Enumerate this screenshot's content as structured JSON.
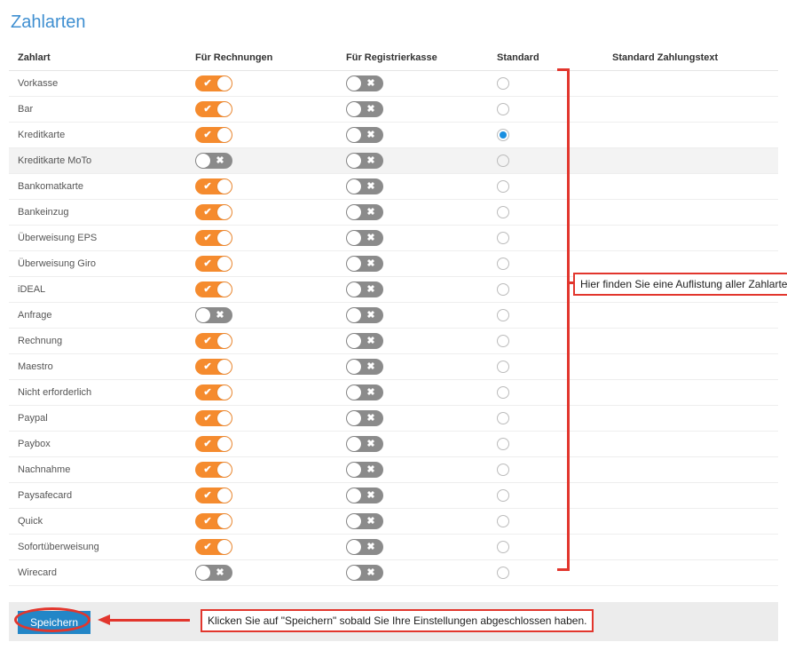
{
  "title": "Zahlarten",
  "columns": {
    "name": "Zahlart",
    "invoice": "Für Rechnungen",
    "register": "Für Registrierkasse",
    "standard": "Standard",
    "text": "Standard Zahlungstext"
  },
  "rows": [
    {
      "name": "Vorkasse",
      "invoice": true,
      "register": false,
      "standard": false,
      "highlight": false
    },
    {
      "name": "Bar",
      "invoice": true,
      "register": false,
      "standard": false,
      "highlight": false
    },
    {
      "name": "Kreditkarte",
      "invoice": true,
      "register": false,
      "standard": true,
      "highlight": false
    },
    {
      "name": "Kreditkarte MoTo",
      "invoice": false,
      "register": false,
      "standard": false,
      "highlight": true
    },
    {
      "name": "Bankomatkarte",
      "invoice": true,
      "register": false,
      "standard": false,
      "highlight": false
    },
    {
      "name": "Bankeinzug",
      "invoice": true,
      "register": false,
      "standard": false,
      "highlight": false
    },
    {
      "name": "Überweisung EPS",
      "invoice": true,
      "register": false,
      "standard": false,
      "highlight": false
    },
    {
      "name": "Überweisung Giro",
      "invoice": true,
      "register": false,
      "standard": false,
      "highlight": false
    },
    {
      "name": "iDEAL",
      "invoice": true,
      "register": false,
      "standard": false,
      "highlight": false
    },
    {
      "name": "Anfrage",
      "invoice": false,
      "register": false,
      "standard": false,
      "highlight": false
    },
    {
      "name": "Rechnung",
      "invoice": true,
      "register": false,
      "standard": false,
      "highlight": false
    },
    {
      "name": "Maestro",
      "invoice": true,
      "register": false,
      "standard": false,
      "highlight": false
    },
    {
      "name": "Nicht erforderlich",
      "invoice": true,
      "register": false,
      "standard": false,
      "highlight": false
    },
    {
      "name": "Paypal",
      "invoice": true,
      "register": false,
      "standard": false,
      "highlight": false
    },
    {
      "name": "Paybox",
      "invoice": true,
      "register": false,
      "standard": false,
      "highlight": false
    },
    {
      "name": "Nachnahme",
      "invoice": true,
      "register": false,
      "standard": false,
      "highlight": false
    },
    {
      "name": "Paysafecard",
      "invoice": true,
      "register": false,
      "standard": false,
      "highlight": false
    },
    {
      "name": "Quick",
      "invoice": true,
      "register": false,
      "standard": false,
      "highlight": false
    },
    {
      "name": "Sofortüberweisung",
      "invoice": true,
      "register": false,
      "standard": false,
      "highlight": false
    },
    {
      "name": "Wirecard",
      "invoice": false,
      "register": false,
      "standard": false,
      "highlight": false
    }
  ],
  "annotations": {
    "list_hint": "Hier finden Sie eine Auflistung aller Zahlarten.",
    "save_hint": "Klicken Sie auf \"Speichern\" sobald Sie Ihre Einstellungen abgeschlossen haben."
  },
  "buttons": {
    "save": "Speichern"
  }
}
